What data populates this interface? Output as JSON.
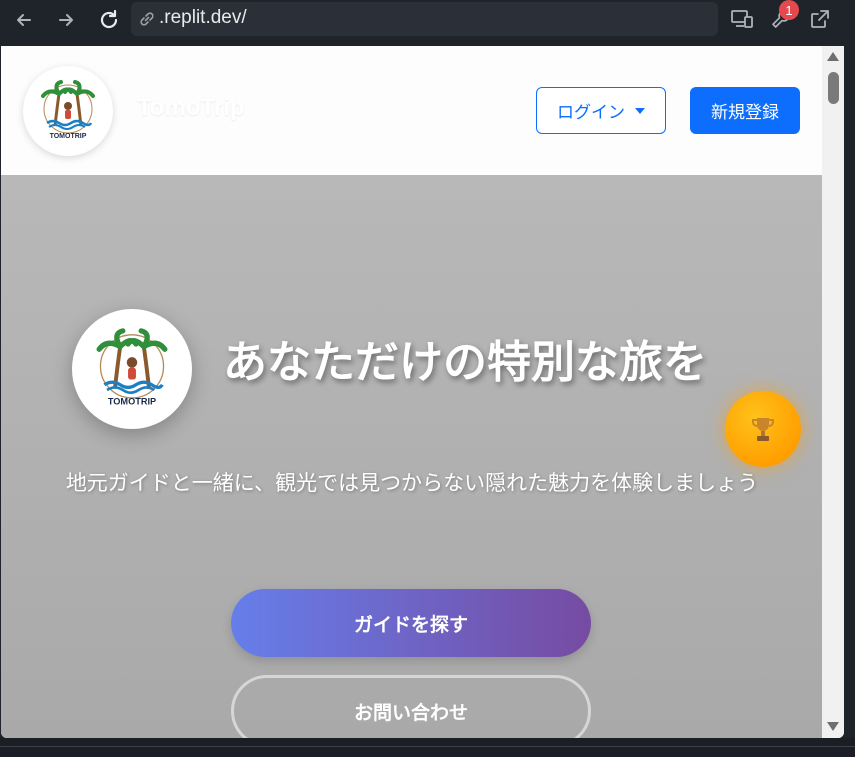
{
  "browser": {
    "url_text": ".replit.dev/",
    "notification_count": "1",
    "icons": [
      "back-icon",
      "forward-icon",
      "reload-icon",
      "link-icon",
      "devices-icon",
      "wrench-icon",
      "open-external-icon"
    ]
  },
  "header": {
    "brand_name": "TomoTrip",
    "logo_text": "TOMOTRIP",
    "login_label": "ログイン",
    "signup_label": "新規登録"
  },
  "hero": {
    "logo_text": "TOMOTRIP",
    "title": "あなただけの特別な旅を",
    "subtitle": "地元ガイドと一緒に、観光では見つからない隠れた魅力を体験しましょう",
    "primary_cta": "ガイドを探す",
    "secondary_cta": "お問い合わせ",
    "fab_icon": "trophy-icon"
  },
  "colors": {
    "primary": "#0d6efd",
    "cta_gradient_start": "#667eea",
    "cta_gradient_end": "#764ba2",
    "fab": "#ffa500"
  }
}
